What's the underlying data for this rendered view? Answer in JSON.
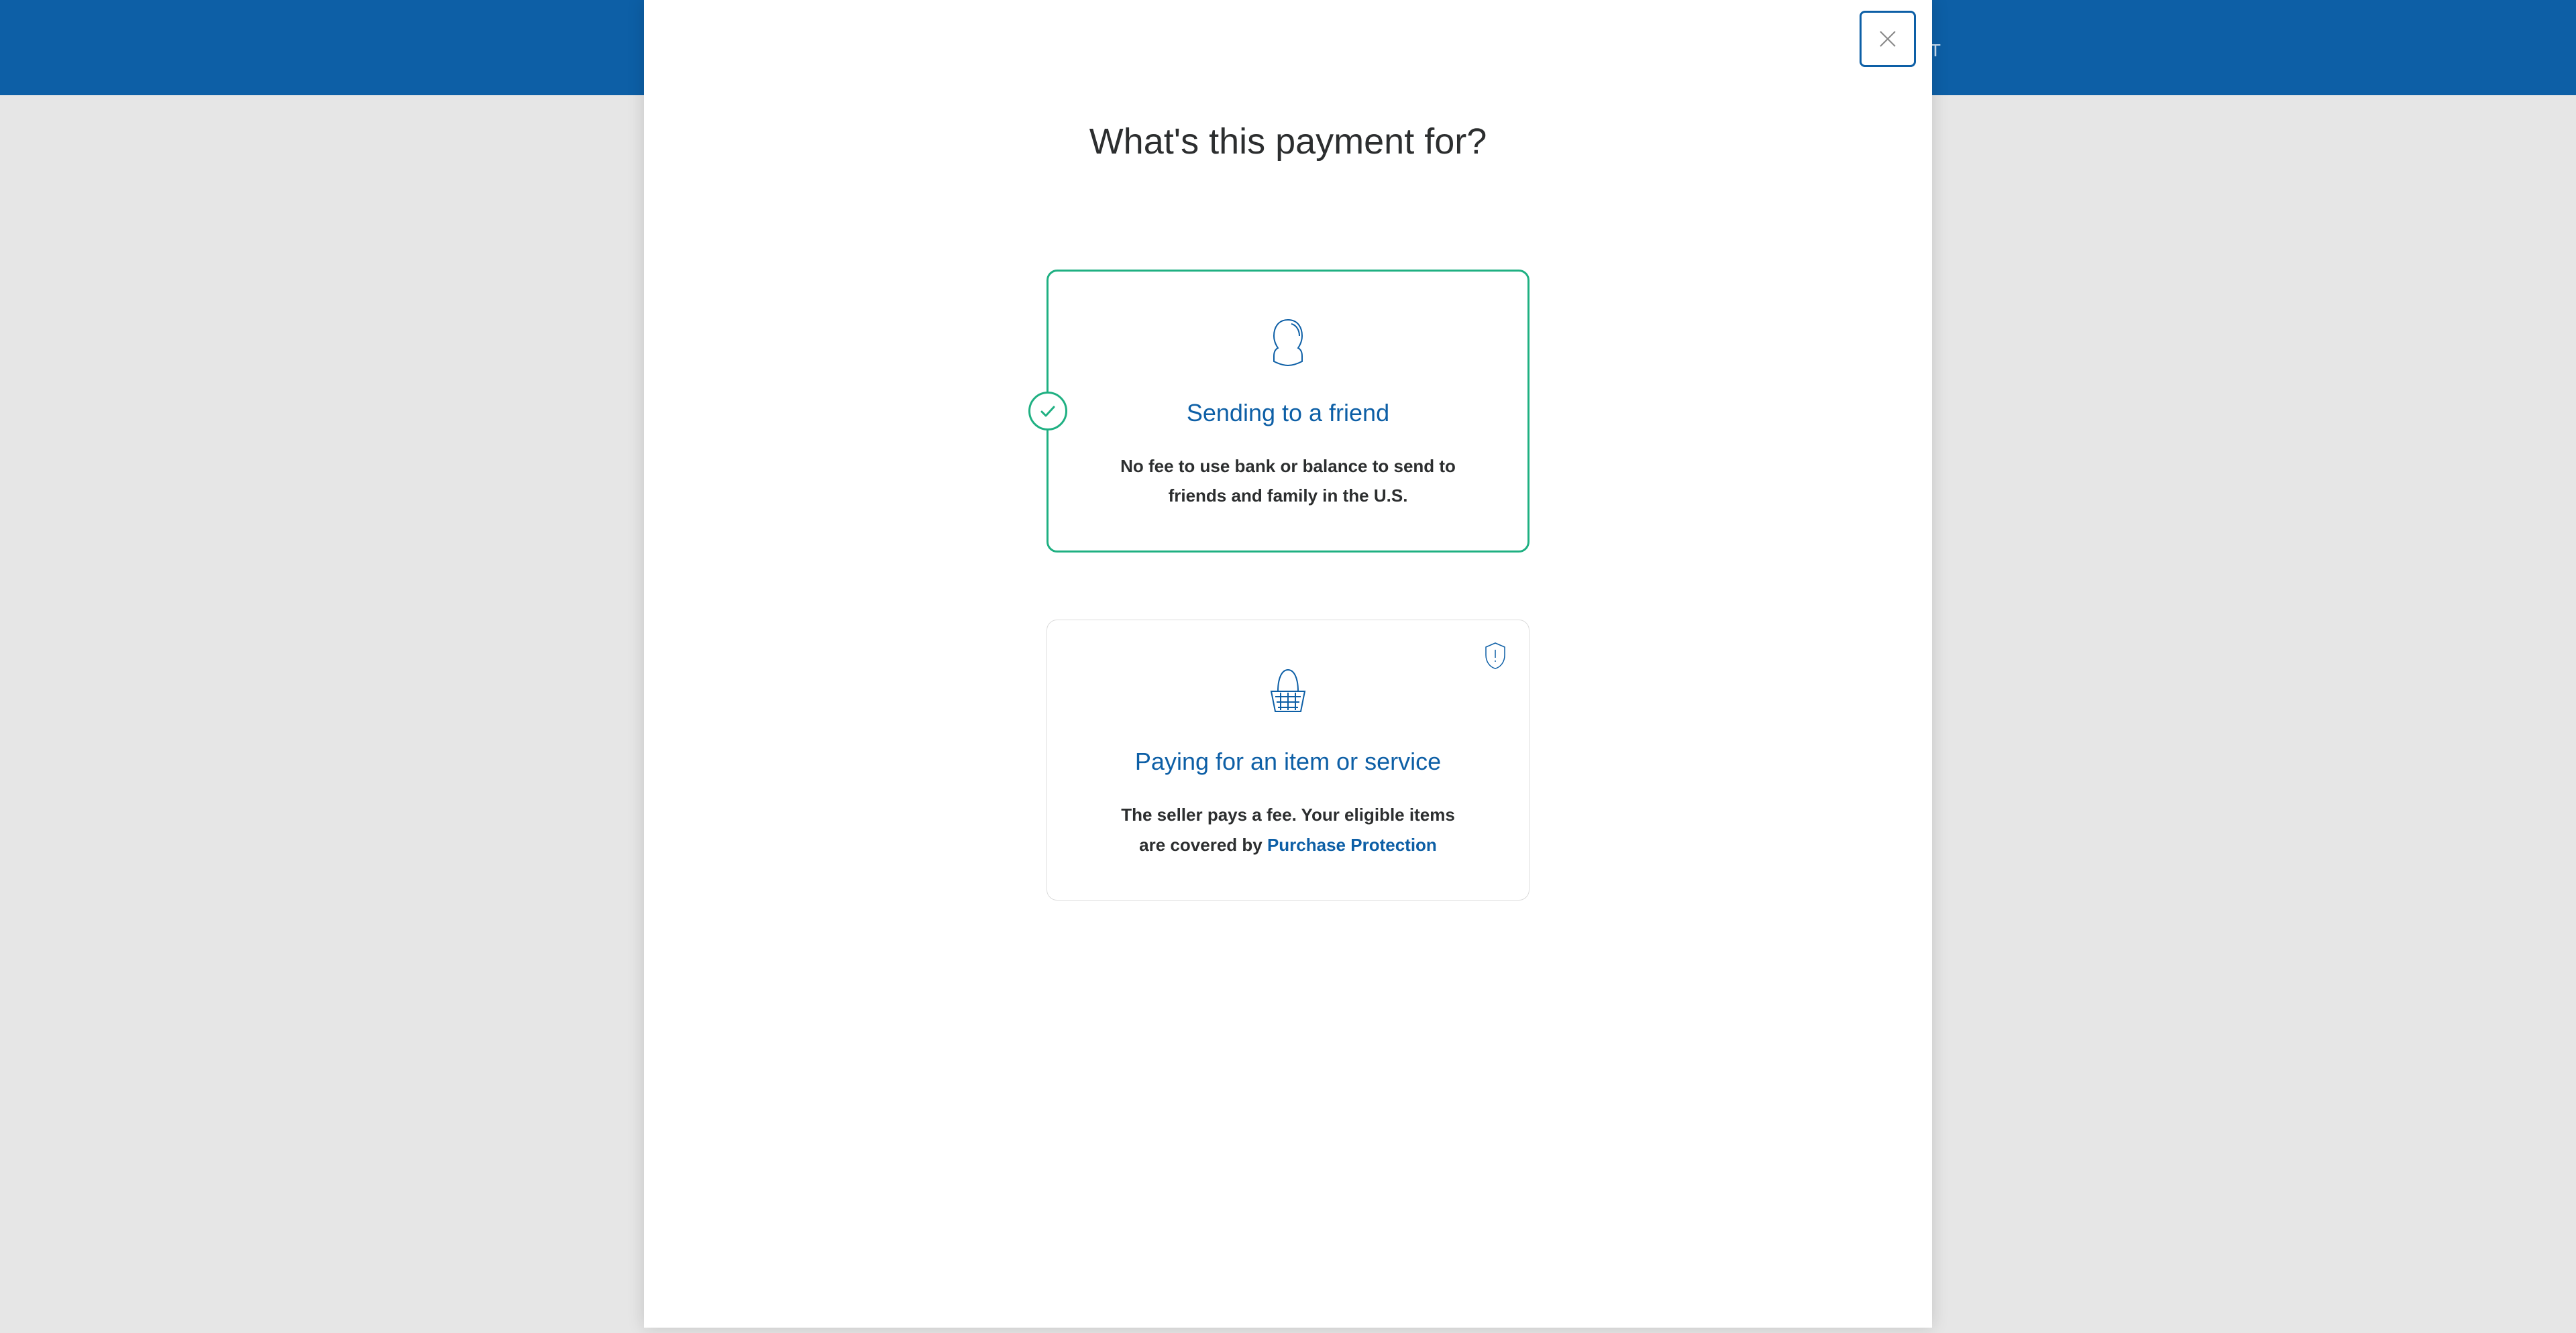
{
  "header": {
    "logout_fragment": "UT"
  },
  "modal": {
    "title": "What's this payment for?",
    "options": {
      "friend": {
        "title": "Sending to a friend",
        "description": "No fee to use bank or balance to send to friends and family in the U.S.",
        "selected": true
      },
      "goods": {
        "title": "Paying for an item or service",
        "description_prefix": "The seller pays a fee. Your eligible items are covered by ",
        "link_text": "Purchase Protection",
        "selected": false
      }
    }
  }
}
